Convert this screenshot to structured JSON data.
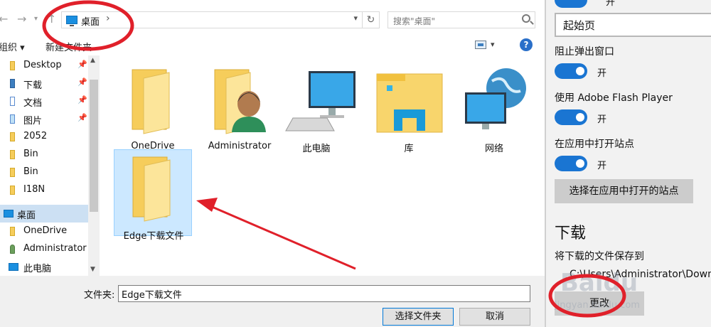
{
  "dialog": {
    "address": {
      "location": "桌面"
    },
    "search": {
      "placeholder": "搜索\"桌面\""
    },
    "toolbar": {
      "organize_label": "组织 ▾",
      "new_folder_label": "新建文件夹"
    },
    "nav_items": [
      {
        "label": "Desktop",
        "pinned": true,
        "icon": "desktop-folder-icon"
      },
      {
        "label": "下载",
        "pinned": true,
        "icon": "download-folder-icon"
      },
      {
        "label": "文档",
        "pinned": true,
        "icon": "documents-folder-icon"
      },
      {
        "label": "图片",
        "pinned": true,
        "icon": "pictures-folder-icon"
      },
      {
        "label": "2052",
        "pinned": false,
        "icon": "folder-icon"
      },
      {
        "label": "Bin",
        "pinned": false,
        "icon": "folder-icon"
      },
      {
        "label": "Bin",
        "pinned": false,
        "icon": "folder-icon"
      },
      {
        "label": "I18N",
        "pinned": false,
        "icon": "folder-icon"
      },
      {
        "label": "桌面",
        "pinned": false,
        "icon": "desktop-icon",
        "selected": true
      },
      {
        "label": "OneDrive",
        "pinned": false,
        "icon": "folder-icon"
      },
      {
        "label": "Administrator",
        "pinned": false,
        "icon": "user-icon"
      },
      {
        "label": "此电脑",
        "pinned": false,
        "icon": "computer-icon"
      }
    ],
    "files": [
      {
        "name": "OneDrive",
        "icon": "folder-icon"
      },
      {
        "name": "Administrator",
        "icon": "user-folder-icon"
      },
      {
        "name": "此电脑",
        "icon": "computer-icon"
      },
      {
        "name": "库",
        "icon": "library-icon"
      },
      {
        "name": "网络",
        "icon": "network-icon"
      },
      {
        "name": "Edge下载文件",
        "icon": "folder-icon",
        "selected": true
      }
    ],
    "footer": {
      "folder_label": "文件夹:",
      "folder_value": "Edge下载文件",
      "select_button": "选择文件夹",
      "cancel_button": "取消"
    }
  },
  "settings": {
    "top_toggle_text": "开",
    "start_page_value": "起始页",
    "popup_label": "阻止弹出窗口",
    "popup_toggle_text": "开",
    "flash_label": "使用 Adobe Flash Player",
    "flash_toggle_text": "开",
    "open_in_app_label": "在应用中打开站点",
    "open_in_app_toggle_text": "开",
    "choose_sites_button": "选择在应用中打开的站点",
    "download_heading": "下载",
    "download_save_label": "将下载的文件保存到",
    "download_path": "C:\\Users\\Administrator\\Down",
    "change_button": "更改"
  },
  "watermark": {
    "logo": "Baidu",
    "url": "jingyan.baidu.com"
  },
  "colors": {
    "accent": "#1a75d2",
    "annotation": "#e0202a",
    "selection": "#cce8ff"
  }
}
